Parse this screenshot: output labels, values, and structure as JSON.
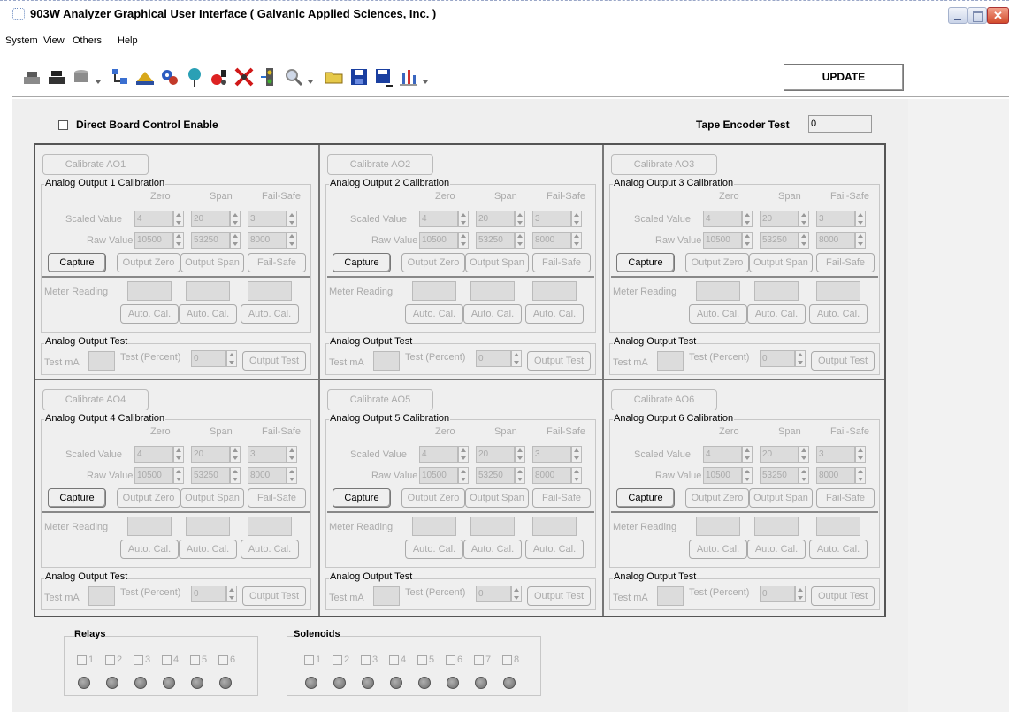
{
  "window": {
    "title": "903W Analyzer Graphical User Interface  ( Galvanic Applied Sciences, Inc. )"
  },
  "menu": [
    "System",
    "View",
    "Others",
    "Help"
  ],
  "toolbar": {
    "icons": [
      "dock-icon",
      "undock-icon",
      "disk-drive-icon",
      "tree-icon",
      "gas-icon",
      "gears-icon",
      "pin-icon",
      "alarm-icon",
      "stop-icon",
      "valve-icon",
      "magnify-icon",
      "folder-open-icon",
      "save-icon",
      "save-as-icon",
      "chart-icon"
    ],
    "update_label": "UPDATE"
  },
  "direct_board_label": "Direct Board Control Enable",
  "tape_encoder": {
    "label": "Tape Encoder Test",
    "value": "0"
  },
  "columns": {
    "zero": "Zero",
    "span": "Span",
    "failsafe": "Fail-Safe"
  },
  "row_labels": {
    "scaled": "Scaled Value",
    "raw": "Raw Value",
    "meter": "Meter Reading",
    "test_ma": "Test mA",
    "test_pct": "Test (Percent)"
  },
  "button_labels": {
    "capture": "Capture",
    "output_zero": "Output Zero",
    "output_span": "Output Span",
    "failsafe": "Fail-Safe",
    "auto_cal": "Auto. Cal.",
    "output_test": "Output Test"
  },
  "test_group_title": "Analog Output Test",
  "panels": [
    {
      "cal_button": "Calibrate AO1",
      "group_title": "Analog Output 1 Calibration",
      "scaled": [
        "4",
        "20",
        "3"
      ],
      "raw": [
        "10500",
        "53250",
        "8000"
      ],
      "test_pct": "0"
    },
    {
      "cal_button": "Calibrate AO2",
      "group_title": "Analog Output 2 Calibration",
      "scaled": [
        "4",
        "20",
        "3"
      ],
      "raw": [
        "10500",
        "53250",
        "8000"
      ],
      "test_pct": "0"
    },
    {
      "cal_button": "Calibrate AO3",
      "group_title": "Analog Output 3 Calibration",
      "scaled": [
        "4",
        "20",
        "3"
      ],
      "raw": [
        "10500",
        "53250",
        "8000"
      ],
      "test_pct": "0"
    },
    {
      "cal_button": "Calibrate AO4",
      "group_title": "Analog Output 4 Calibration",
      "scaled": [
        "4",
        "20",
        "3"
      ],
      "raw": [
        "10500",
        "53250",
        "8000"
      ],
      "test_pct": "0"
    },
    {
      "cal_button": "Calibrate AO5",
      "group_title": "Analog Output 5 Calibration",
      "scaled": [
        "4",
        "20",
        "3"
      ],
      "raw": [
        "10500",
        "53250",
        "8000"
      ],
      "test_pct": "0"
    },
    {
      "cal_button": "Calibrate AO6",
      "group_title": "Analog Output 6 Calibration",
      "scaled": [
        "4",
        "20",
        "3"
      ],
      "raw": [
        "10500",
        "53250",
        "8000"
      ],
      "test_pct": "0"
    }
  ],
  "relays": {
    "title": "Relays",
    "items": [
      "1",
      "2",
      "3",
      "4",
      "5",
      "6"
    ]
  },
  "solenoids": {
    "title": "Solenoids",
    "items": [
      "1",
      "2",
      "3",
      "4",
      "5",
      "6",
      "7",
      "8"
    ]
  }
}
